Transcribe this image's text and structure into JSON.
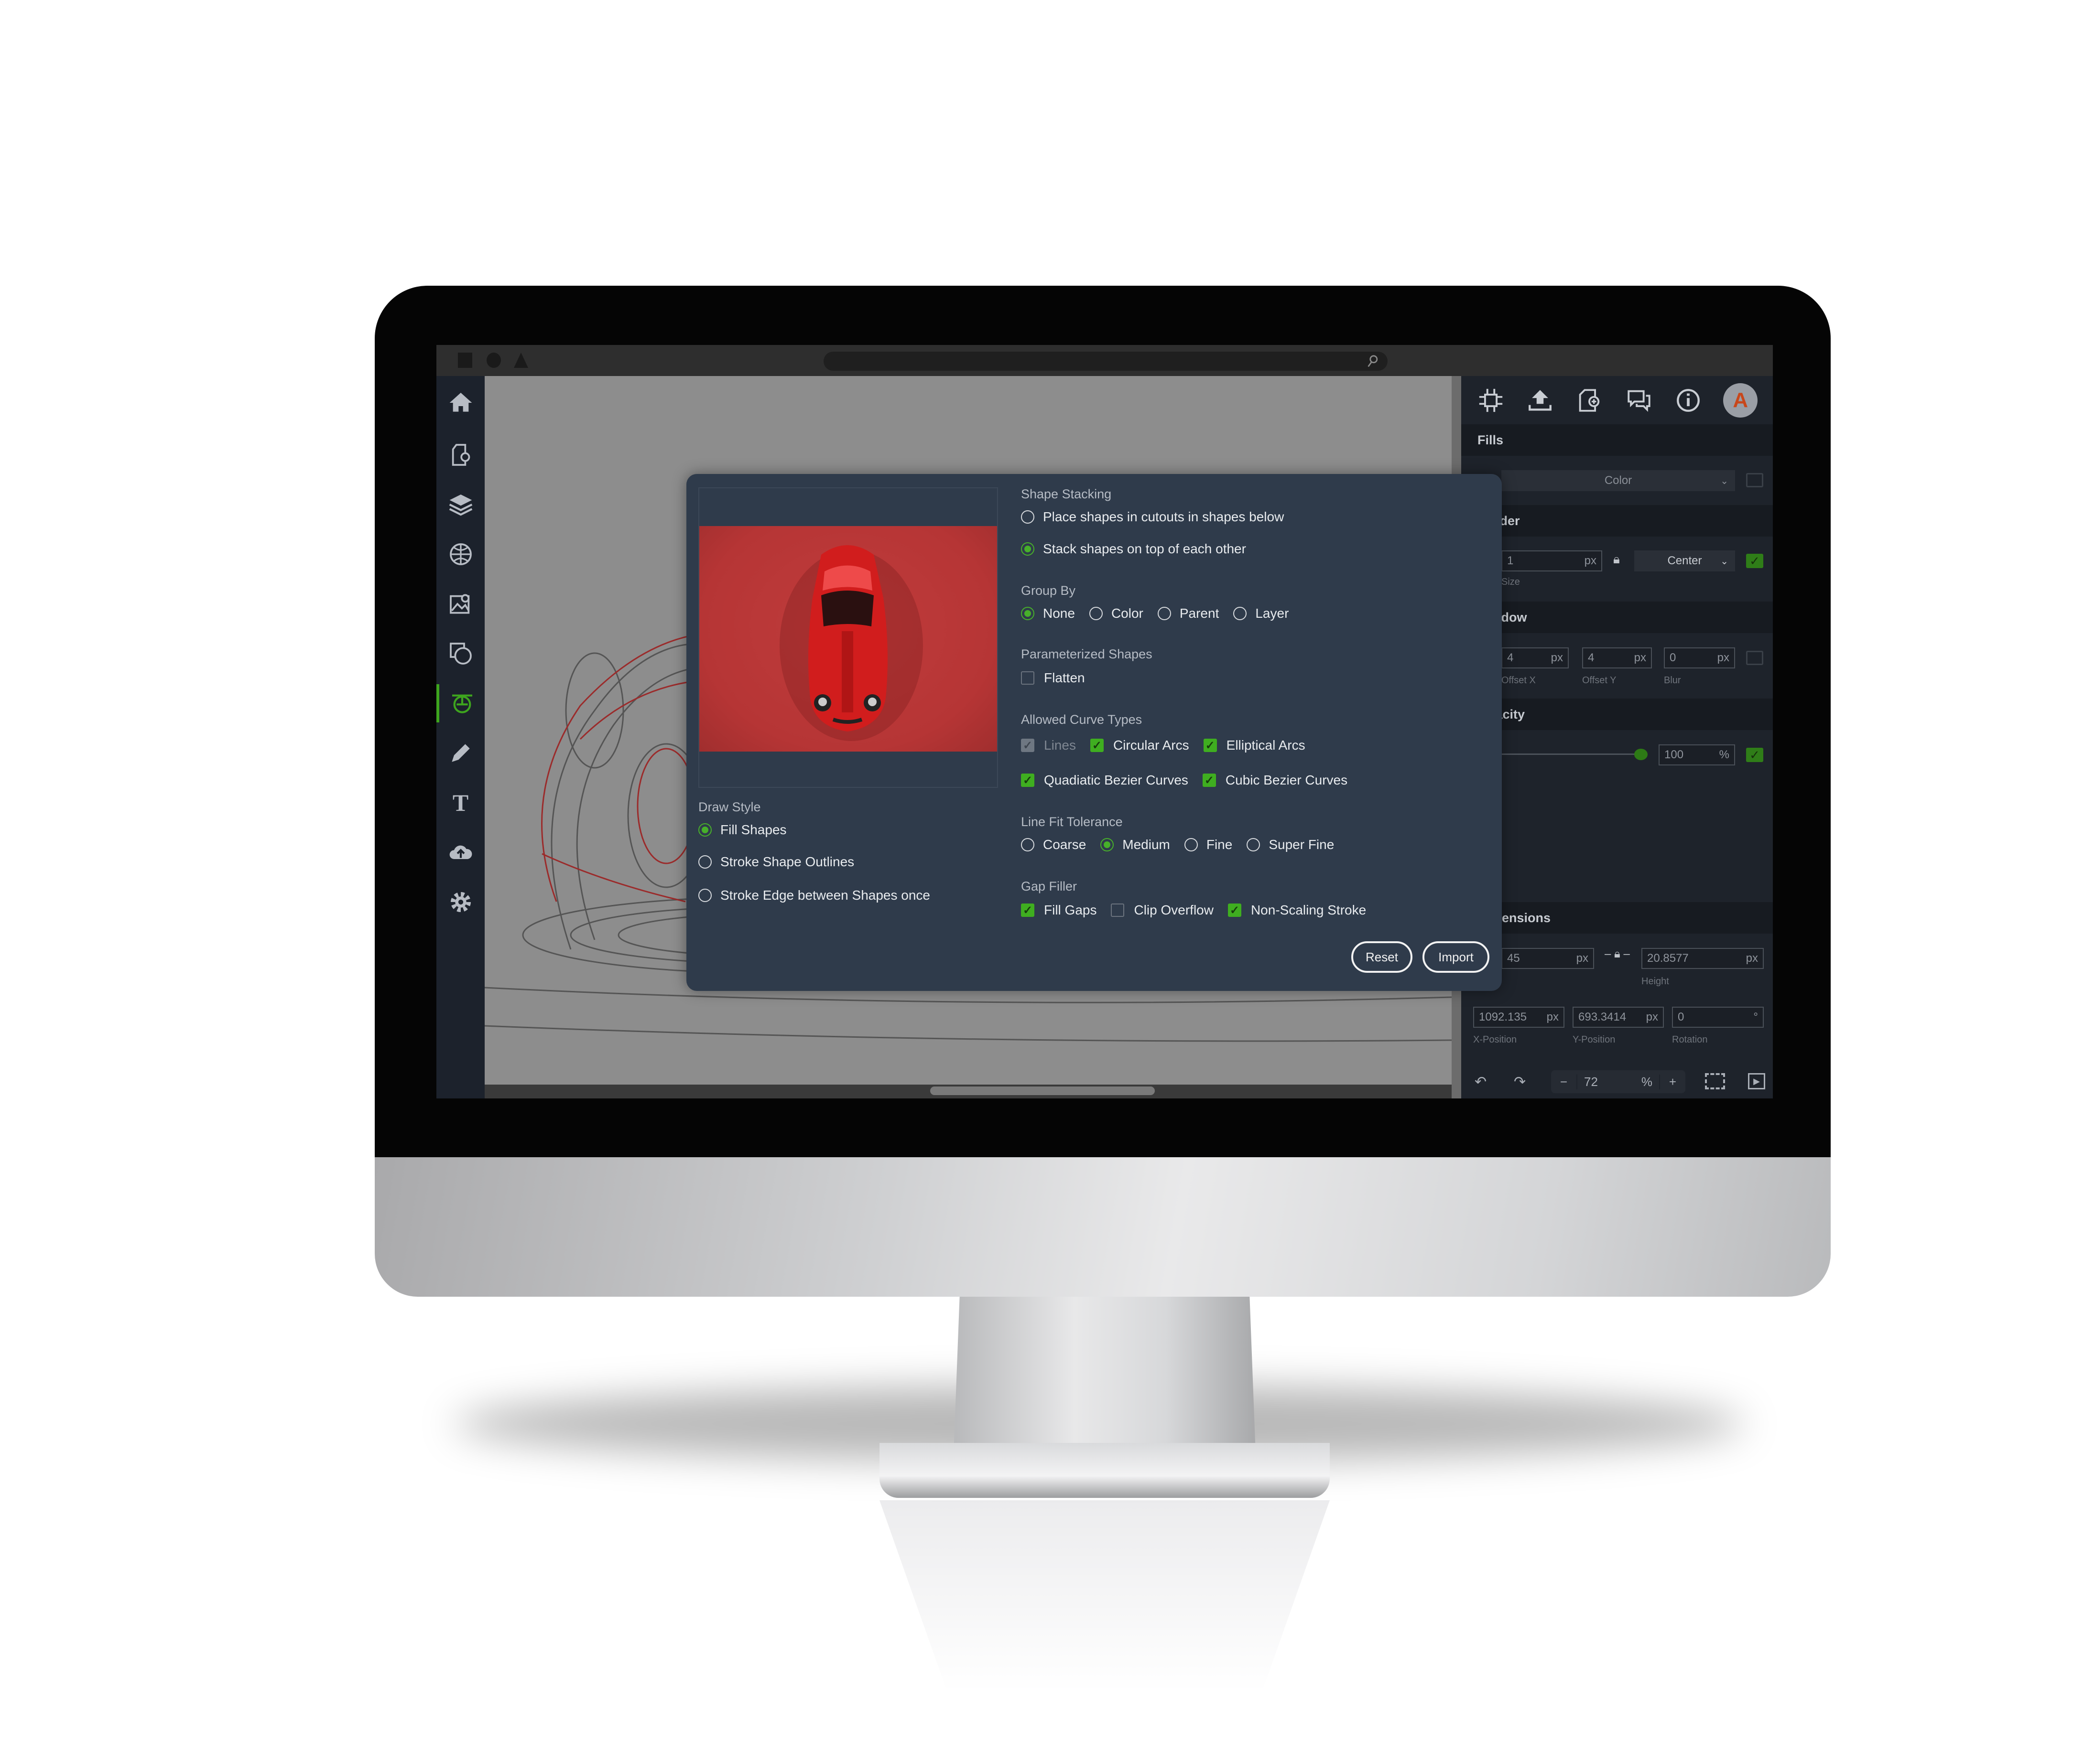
{
  "titlebar": {
    "search_icon": "search-icon"
  },
  "sidebar": {
    "items": [
      {
        "name": "home",
        "icon": "home-icon"
      },
      {
        "name": "new-document",
        "icon": "document-gear-icon"
      },
      {
        "name": "layers",
        "icon": "layers-icon"
      },
      {
        "name": "globe",
        "icon": "globe-icon"
      },
      {
        "name": "image",
        "icon": "image-search-icon"
      },
      {
        "name": "shapes",
        "icon": "shapes-icon"
      },
      {
        "name": "vectorize",
        "icon": "vectorize-icon",
        "active": true
      },
      {
        "name": "pencil",
        "icon": "pencil-icon"
      },
      {
        "name": "text",
        "icon": "text-icon",
        "glyph": "T"
      },
      {
        "name": "cloud",
        "icon": "cloud-upload-icon"
      },
      {
        "name": "settings",
        "icon": "gear-icon"
      }
    ],
    "accent": "#3ea51e"
  },
  "right_panel": {
    "avatar_letter": "A",
    "fills": {
      "title": "Fills",
      "type": "Color"
    },
    "border": {
      "title": "Border",
      "size": "1",
      "unit": "px",
      "size_label": "Size",
      "align": "Center",
      "enabled": true
    },
    "shadow": {
      "title": "Shadow",
      "offset_x": "4",
      "offset_y": "4",
      "blur": "0",
      "unit": "px",
      "offset_x_label": "Offset X",
      "offset_y_label": "Offset Y",
      "blur_label": "Blur",
      "enabled": false
    },
    "opacity": {
      "title": "Opacity",
      "value": "100",
      "unit": "%",
      "enabled": true,
      "slider_percent": 100
    },
    "dimensions": {
      "title": "Dimensions",
      "width": "45",
      "height": "20.8577",
      "unit": "px",
      "height_label": "Height",
      "x": "1092.135",
      "y": "693.3414",
      "rotation": "0",
      "deg": "°",
      "x_label": "X-Position",
      "y_label": "Y-Position",
      "rotation_label": "Rotation"
    },
    "bottom": {
      "zoom": "72",
      "zoom_unit": "%",
      "minus": "−",
      "plus": "+"
    }
  },
  "dialog": {
    "draw_style": {
      "title": "Draw Style",
      "options": [
        "Fill Shapes",
        "Stroke Shape Outlines",
        "Stroke Edge between Shapes once"
      ],
      "selected": 0
    },
    "shape_stacking": {
      "title": "Shape Stacking",
      "options": [
        "Place shapes in cutouts in shapes below",
        "Stack shapes on top of each other"
      ],
      "selected": 1
    },
    "group_by": {
      "title": "Group By",
      "options": [
        "None",
        "Color",
        "Parent",
        "Layer"
      ],
      "selected": 0
    },
    "parameterized": {
      "title": "Parameterized Shapes",
      "flatten": "Flatten",
      "flatten_checked": false
    },
    "curve_types": {
      "title": "Allowed Curve Types",
      "lines": "Lines",
      "circular": "Circular Arcs",
      "elliptical": "Elliptical Arcs",
      "quadratic": "Quadiatic Bezier Curves",
      "cubic": "Cubic Bezier Curves"
    },
    "line_fit": {
      "title": "Line Fit Tolerance",
      "options": [
        "Coarse",
        "Medium",
        "Fine",
        "Super Fine"
      ],
      "selected": 1
    },
    "gap_filler": {
      "title": "Gap Filler",
      "fill_gaps": "Fill Gaps",
      "clip_overflow": "Clip Overflow",
      "non_scaling": "Non-Scaling Stroke"
    },
    "reset": "Reset",
    "import": "Import"
  }
}
